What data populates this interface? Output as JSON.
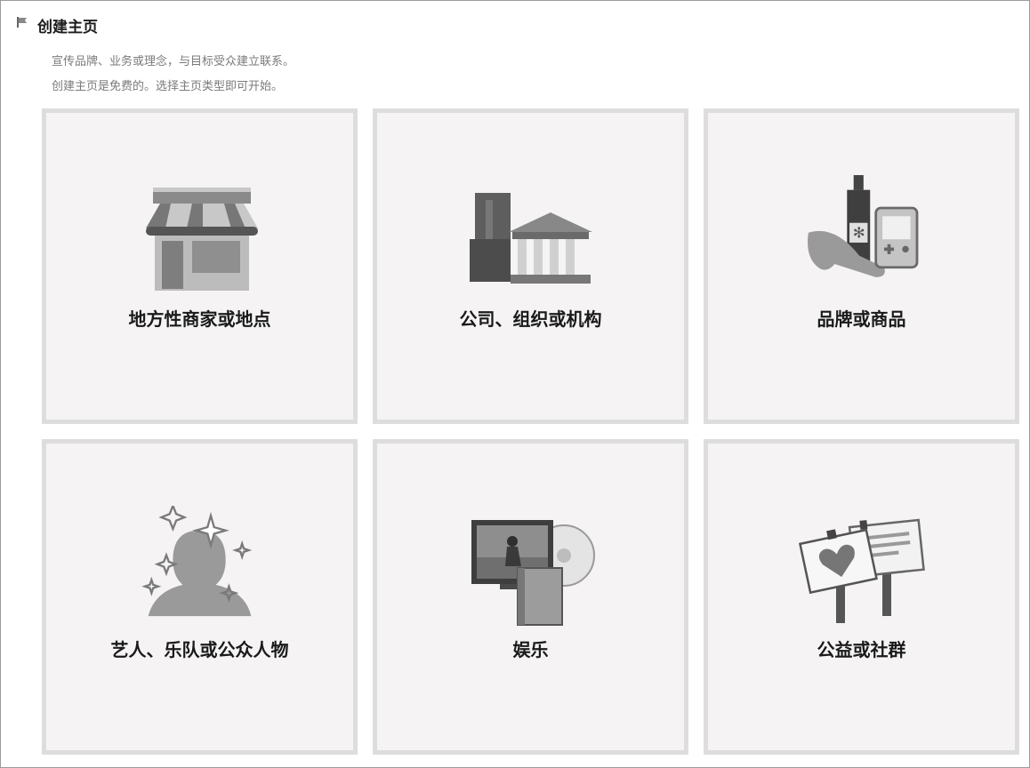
{
  "header": {
    "title": "创建主页",
    "description_line1": "宣传品牌、业务或理念，与目标受众建立联系。",
    "description_line2": "创建主页是免费的。选择主页类型即可开始。"
  },
  "categories": [
    {
      "label": "地方性商家或地点",
      "icon": "storefront-icon"
    },
    {
      "label": "公司、组织或机构",
      "icon": "buildings-icon"
    },
    {
      "label": "品牌或商品",
      "icon": "products-icon"
    },
    {
      "label": "艺人、乐队或公众人物",
      "icon": "public-figure-icon"
    },
    {
      "label": "娱乐",
      "icon": "entertainment-icon"
    },
    {
      "label": "公益或社群",
      "icon": "community-icon"
    }
  ],
  "colors": {
    "card_bg": "#f5f3f4",
    "card_border": "#dddddd",
    "icon_dark": "#555555",
    "icon_mid": "#8a8a8a",
    "icon_light": "#c8c8c8"
  }
}
